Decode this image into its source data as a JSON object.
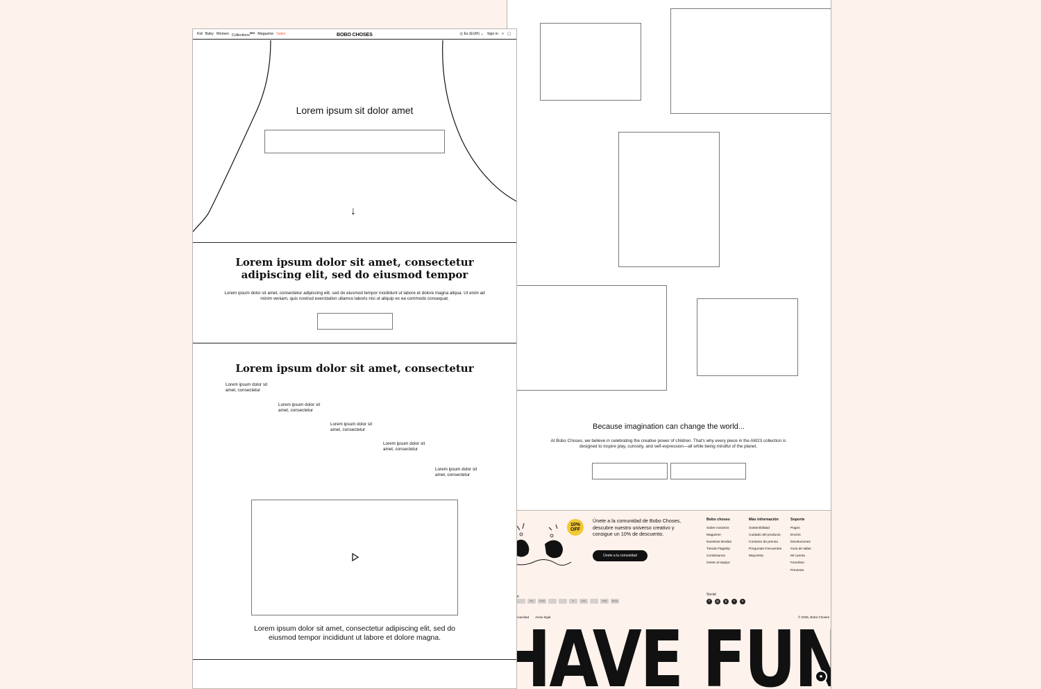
{
  "nav": {
    "links": [
      {
        "label": "Kid"
      },
      {
        "label": "Baby"
      },
      {
        "label": "Women"
      },
      {
        "label": "Collections",
        "badge": "NEW"
      },
      {
        "label": "Magazine"
      },
      {
        "label": "Sales"
      }
    ],
    "logo": "BOBO CHOSES",
    "currency": "Es (EUR)",
    "sign_in": "Sign in",
    "icons": [
      "globe-icon",
      "chevron-down-icon",
      "search-icon",
      "bag-icon"
    ]
  },
  "hero": {
    "title": "Lorem ipsum sit dolor amet",
    "scroll_glyph": "↓"
  },
  "intro": {
    "title": "Lorem ipsum dolor sit amet, consectetur adipiscing elit, sed do eiusmod tempor",
    "text": "Lorem ipsum dolor sit amet, consectetur adipiscing elit, sed do eiusmod tempor incididunt ut labore et dolore magna aliqua. Ut enim ad minim veniam, quis nostrud exercitation ullamco laboris nisi ut aliquip ex ea commodo consequat."
  },
  "features": {
    "title": "Lorem ipsum dolor sit amet, consectetur",
    "steps": [
      "Lorem ipsum dolor sit amet, consectetur",
      "Lorem ipsum dolor sit amet, consectetur",
      "Lorem ipsum dolor sit amet, consectetur",
      "Lorem ipsum dolor sit amet, consectetur",
      "Lorem ipsum dolor sit amet, consectetur"
    ],
    "video_caption": "Lorem ipsum dolor sit amet, consectetur adipiscing elit, sed do eiusmod tempor incididunt ut labore et dolore magna."
  },
  "imagination": {
    "title": "Because imagination can change the world...",
    "text": "At Bobo Choses, we believe in celebrating the creative power of children. That's why every piece in the AW23 collection is designed to inspire play, curiosity, and self-expression—all while being mindful of the planet."
  },
  "footer": {
    "badge_line1": "10%",
    "badge_line2": "OFF",
    "community_text": "Únete a la comunidad de Bobo Choses, descubre nuestro universo creativo y consigue un 10% de descuento.",
    "community_button": "Únete a la comunidad",
    "columns": [
      {
        "heading": "Bobo choses",
        "links": [
          "Sobre nosotros",
          "Magazine",
          "Nuestras tiendas",
          "Tienda Flagship",
          "Contáctanos",
          "Únete al equipo"
        ]
      },
      {
        "heading": "Más información",
        "links": [
          "Sostenibilidad",
          "Cuidado del producto",
          "Contacto de prensa",
          "Preguntas Frecuentes",
          "Mayorista"
        ]
      },
      {
        "heading": "Soporte",
        "links": [
          "Pagos",
          "Envíos",
          "Devoluciones",
          "Guía de tallas",
          "Mi cuenta",
          "Favoritos",
          "Preventa"
        ]
      }
    ],
    "payments_label": "ptamos:",
    "payments": [
      "",
      "Pay",
      "G Pay",
      "",
      "",
      "P",
      "shop",
      "",
      "VISA",
      "klarna"
    ],
    "social_label": "Social",
    "social": [
      "facebook-icon",
      "instagram-icon",
      "pinterest-icon",
      "spotify-icon",
      "vimeo-icon"
    ],
    "legal": [
      "a de privacidad",
      "Aviso legal"
    ],
    "copyright": "© 2025, Bobo Choses",
    "big_text": "HAVE FUN"
  },
  "colors": {
    "background": "#fdf2ec",
    "sales": "#ff5a2c",
    "badge": "#f3c833",
    "ink": "#111111"
  }
}
